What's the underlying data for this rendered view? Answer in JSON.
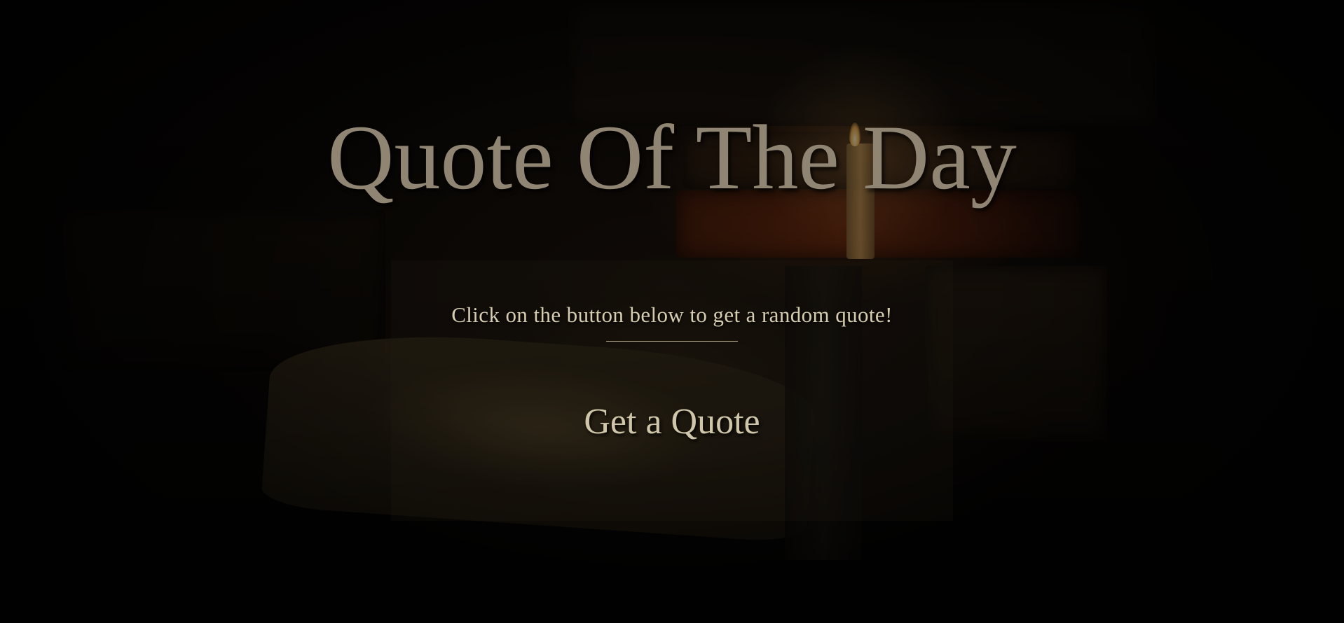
{
  "page": {
    "title": "Quote Of The Day"
  },
  "main": {
    "prompt": "Click on the button below to get a random quote!",
    "button_label": "Get a Quote"
  },
  "background": {
    "description_icon": "candle-books-painting",
    "accent_color": "#8f8572",
    "text_color": "#d6ccb0"
  }
}
